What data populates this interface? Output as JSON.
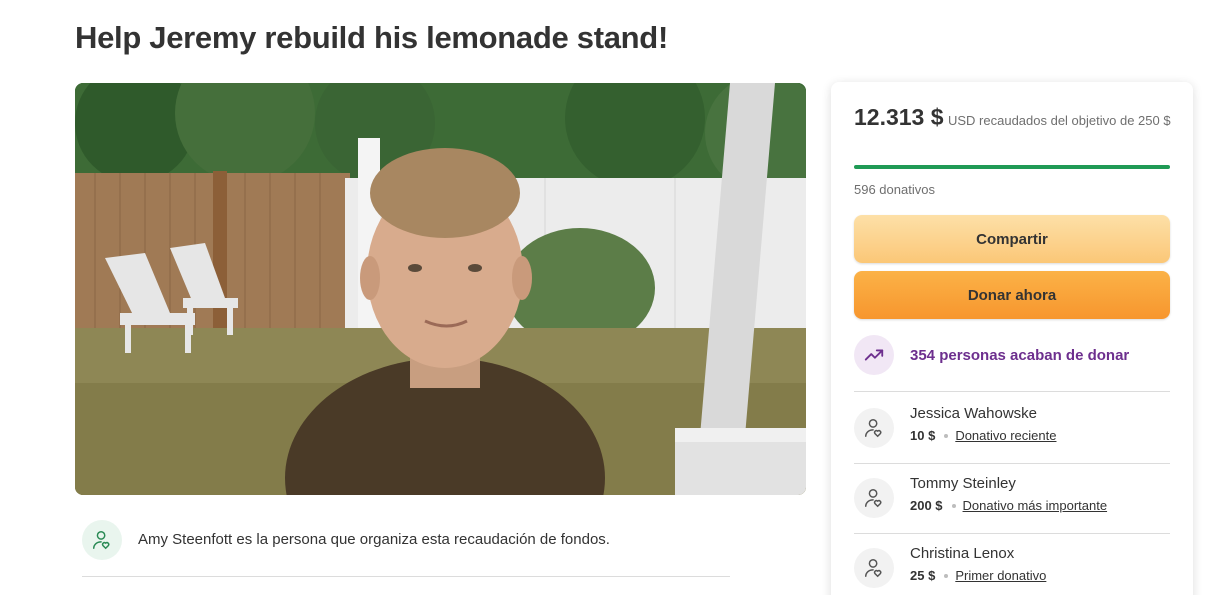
{
  "campaign": {
    "title": "Help Jeremy rebuild his lemonade stand!"
  },
  "organizer": {
    "text": "Amy Steenfott es la persona que organiza esta recaudación de fondos.",
    "icon": "person-heart-icon"
  },
  "donation_card": {
    "amount_raised": "12.313 $",
    "goal_text": "USD recaudados del objetivo de 250 $",
    "progress_fraction": 1.0,
    "donation_count": "596 donativos",
    "share_label": "Compartir",
    "donate_label": "Donar ahora",
    "trending_text": "354 personas acaban de donar",
    "trending_icon": "trending-up-icon",
    "donors": [
      {
        "name": "Jessica Wahowske",
        "amount": "10 $",
        "tag": "Donativo reciente"
      },
      {
        "name": "Tommy Steinley",
        "amount": "200 $",
        "tag": "Donativo más importante"
      },
      {
        "name": "Christina Lenox",
        "amount": "25 $",
        "tag": "Primer donativo"
      }
    ]
  },
  "colors": {
    "progress": "#1f9a55",
    "share_button": "#fbc777",
    "donate_button": "#f7962e",
    "trending_text": "#6d2f8e"
  }
}
